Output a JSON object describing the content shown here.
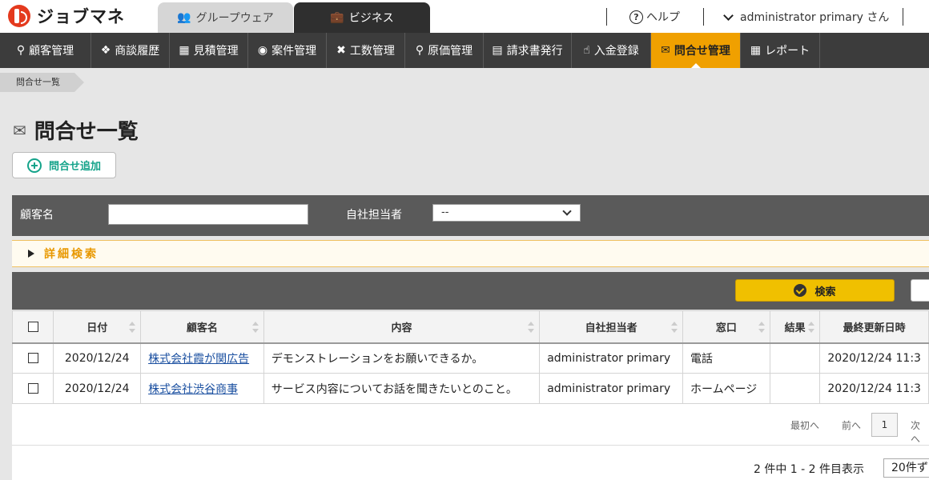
{
  "app": {
    "logo_text": "ジョブマネ"
  },
  "top_tabs": [
    {
      "label": "グループウェア",
      "icon": "people-icon"
    },
    {
      "label": "ビジネス",
      "icon": "briefcase-icon"
    }
  ],
  "header": {
    "help_label": "ヘルプ",
    "user_label": "administrator primary さん"
  },
  "nav": [
    {
      "label": "顧客管理",
      "icon": "person-icon"
    },
    {
      "label": "商談履歴",
      "icon": "handshake-icon"
    },
    {
      "label": "見積管理",
      "icon": "calculator-icon"
    },
    {
      "label": "案件管理",
      "icon": "camera-icon"
    },
    {
      "label": "工数管理",
      "icon": "tools-icon"
    },
    {
      "label": "原価管理",
      "icon": "money-bag-icon"
    },
    {
      "label": "請求書発行",
      "icon": "invoice-icon"
    },
    {
      "label": "入金登録",
      "icon": "deposit-icon"
    },
    {
      "label": "問合せ管理",
      "icon": "inquiry-icon",
      "active": true
    },
    {
      "label": "レポート",
      "icon": "report-icon"
    }
  ],
  "breadcrumb": "問合せ一覧",
  "page_title": "問合せ一覧",
  "add_button_label": "問合せ追加",
  "search": {
    "customer_label": "顧客名",
    "customer_value": "",
    "staff_label": "自社担当者",
    "staff_value": "--",
    "detail_toggle_label": "詳細検索",
    "search_button_label": "検索"
  },
  "table": {
    "columns": [
      "日付",
      "顧客名",
      "内容",
      "自社担当者",
      "窓口",
      "結果",
      "最終更新日時"
    ],
    "rows": [
      {
        "date": "2020/12/24",
        "customer": "株式会社霞が関広告",
        "content": "デモンストレーションをお願いできるか。",
        "staff": "administrator primary",
        "channel": "電話",
        "result": "",
        "updated": "2020/12/24 11:3"
      },
      {
        "date": "2020/12/24",
        "customer": "株式会社渋谷商事",
        "content": "サービス内容についてお話を聞きたいとのこと。",
        "staff": "administrator primary",
        "channel": "ホームページ",
        "result": "",
        "updated": "2020/12/24 11:3"
      }
    ]
  },
  "pager": {
    "first_label": "最初へ",
    "prev_label": "前へ",
    "current_page": "1",
    "next_label": "次へ"
  },
  "summary": {
    "count_text": "2 件中 1 - 2 件目表示",
    "per_page_value": "20件ず"
  }
}
